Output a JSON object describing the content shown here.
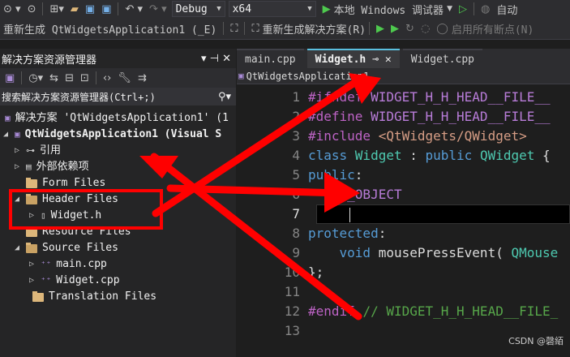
{
  "toolbar1": {
    "config": "Debug",
    "platform": "x64",
    "run_label": "本地 Windows 调试器",
    "auto_label": "自动"
  },
  "toolbar2": {
    "rebuild_project": "重新生成 QtWidgetsApplication1 (_E)",
    "rebuild_solution": "重新生成解决方案(R)",
    "enable_breakpoints": "启用所有断点(N)"
  },
  "solution_explorer": {
    "title": "解决方案资源管理器",
    "pin_glyphs": "▾ ⊣ ✕",
    "search_placeholder": "搜索解决方案资源管理器(Ctrl+;)",
    "tree": [
      {
        "label": "解决方案 'QtWidgetsApplication1' (1",
        "indent": 0
      },
      {
        "label": "QtWidgetsApplication1 (Visual S",
        "indent": 1
      },
      {
        "label": "引用",
        "indent": 2
      },
      {
        "label": "外部依赖项",
        "indent": 2
      },
      {
        "label": "Form Files",
        "indent": 2
      },
      {
        "label": "Header Files",
        "indent": 2
      },
      {
        "label": "Widget.h",
        "indent": 3
      },
      {
        "label": "Resource Files",
        "indent": 2
      },
      {
        "label": "Source Files",
        "indent": 2
      },
      {
        "label": "main.cpp",
        "indent": 3
      },
      {
        "label": "Widget.cpp",
        "indent": 3
      },
      {
        "label": "Translation Files",
        "indent": 2
      }
    ]
  },
  "editor": {
    "tabs": [
      {
        "label": "main.cpp"
      },
      {
        "label": "Widget.h",
        "active": true
      },
      {
        "label": "Widget.cpp"
      }
    ],
    "active_tab_glyphs": "⊸ ✕",
    "nav_project": "QtWidgetsApplication1",
    "lines": [
      {
        "n": "1",
        "parts": [
          [
            "kw-macro",
            "#ifndef "
          ],
          [
            "purple",
            "WIDGET_H_H_HEAD__FILE__"
          ]
        ]
      },
      {
        "n": "2",
        "parts": [
          [
            "kw-macro",
            "#define "
          ],
          [
            "purple",
            "WIDGET_H_H_HEAD__FILE__"
          ]
        ]
      },
      {
        "n": "3",
        "parts": [
          [
            "kw-macro",
            "#include "
          ],
          [
            "inc",
            "<QtWidgets/QWidget>"
          ]
        ]
      },
      {
        "n": "4",
        "parts": [
          [
            "kw",
            "class "
          ],
          [
            "type",
            "Widget"
          ],
          [
            "txt",
            " : "
          ],
          [
            "kw",
            "public "
          ],
          [
            "type",
            "QWidget"
          ],
          [
            "txt",
            " {"
          ]
        ]
      },
      {
        "n": "5",
        "parts": [
          [
            "kw",
            "public"
          ],
          [
            "txt",
            ":"
          ]
        ]
      },
      {
        "n": "6",
        "parts": [
          [
            "txt",
            "    "
          ],
          [
            "purple",
            "Q_OBJECT"
          ]
        ]
      },
      {
        "n": "7",
        "parts": [
          [
            "txt",
            ""
          ]
        ]
      },
      {
        "n": "8",
        "parts": [
          [
            "kw",
            "protected"
          ],
          [
            "txt",
            ":"
          ]
        ]
      },
      {
        "n": "9",
        "parts": [
          [
            "txt",
            "    "
          ],
          [
            "kw",
            "void "
          ],
          [
            "txt",
            "mousePressEvent( "
          ],
          [
            "type",
            "QMouse"
          ]
        ]
      },
      {
        "n": "10",
        "parts": [
          [
            "txt",
            "};"
          ]
        ]
      },
      {
        "n": "11",
        "parts": [
          [
            "txt",
            ""
          ]
        ]
      },
      {
        "n": "12",
        "parts": [
          [
            "kw-macro",
            "#endif "
          ],
          [
            "cmt",
            "// WIDGET_H_H_HEAD__FILE_"
          ]
        ]
      },
      {
        "n": "13",
        "parts": [
          [
            "txt",
            ""
          ]
        ]
      }
    ]
  },
  "watermark": "CSDN @磬絔",
  "colors": {
    "annotation": "#ff0000",
    "accent": "#5bc0de"
  }
}
